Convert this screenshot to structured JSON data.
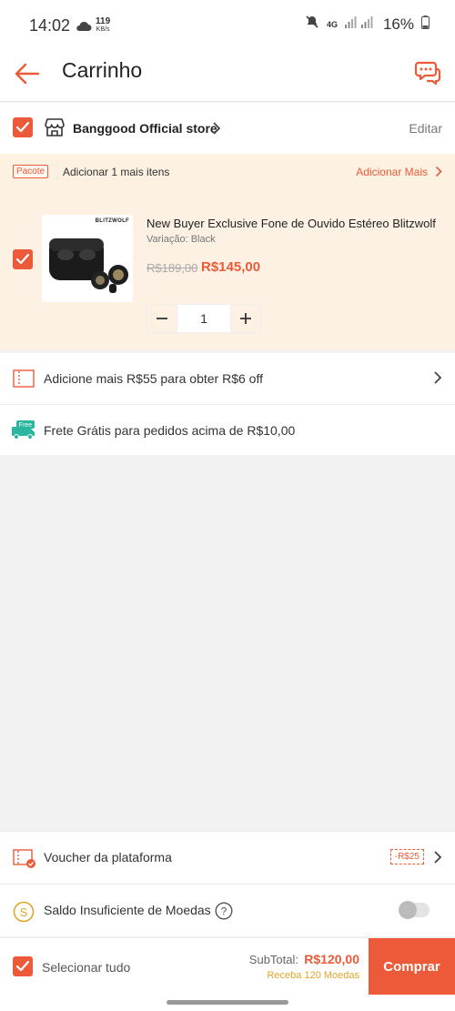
{
  "status_bar": {
    "time": "14:02",
    "net_speed_value": "119",
    "net_speed_unit": "KB/s",
    "network": "4G",
    "battery": "16%"
  },
  "header": {
    "title": "Carrinho"
  },
  "store": {
    "name": "Banggood Official store",
    "edit": "Editar"
  },
  "bundle": {
    "tag": "Pacote",
    "text": "Adicionar 1 mais itens",
    "link": "Adicionar Mais"
  },
  "product": {
    "brand": "BLITZWOLF",
    "title": "New Buyer Exclusive Fone de Ouvido Estéreo Blitzwolf",
    "variation": "Variação: Black",
    "old_price": "R$189,00",
    "price": "R$145,00",
    "quantity": "1"
  },
  "promos": {
    "discount": "Adicione mais R$55 para obter R$6 off",
    "free_badge": "Free",
    "shipping": "Frete Grátis para pedidos acima de R$10,00"
  },
  "voucher": {
    "label": "Voucher da plataforma",
    "badge": "-R$25"
  },
  "coins": {
    "label": "Saldo Insuficiente de Moedas",
    "toggle_on": false
  },
  "checkout": {
    "select_all": "Selecionar tudo",
    "subtotal_label": "SubTotal:",
    "subtotal_value": "R$120,00",
    "coins_reward": "Receba 120 Moedas",
    "buy_button": "Comprar"
  },
  "colors": {
    "accent": "#ec5a39",
    "bundle_bg": "#fdf1e1",
    "coins": "#e0a52a"
  }
}
